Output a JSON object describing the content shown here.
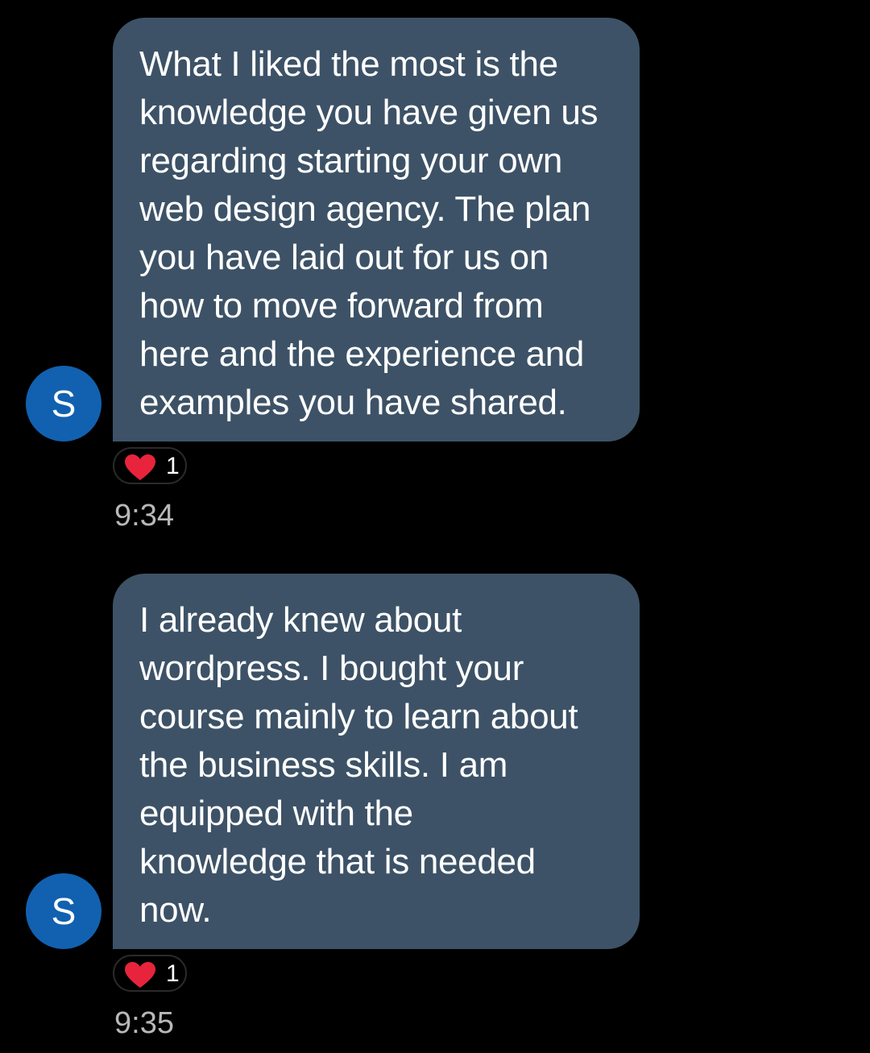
{
  "messages": [
    {
      "sender_initial": "S",
      "text": "What I liked the most is the\nknowledge you have given us\nregarding starting your own\nweb design agency. The plan\nyou have laid out for us on\nhow to move forward from\nhere and the experience and\nexamples you have shared.",
      "reaction": {
        "icon": "heart-icon",
        "count": "1",
        "color": "#e8243c"
      },
      "time": "9:34"
    },
    {
      "sender_initial": "S",
      "text": "I already knew about\nwordpress. I bought your\ncourse mainly to learn about\nthe business skills. I am\nequipped with the\nknowledge that is needed\nnow.",
      "reaction": {
        "icon": "heart-icon",
        "count": "1",
        "color": "#e8243c"
      },
      "time": "9:35"
    }
  ],
  "colors": {
    "background": "#000000",
    "bubble": "#3d5266",
    "avatar": "#1161b0",
    "timestamp": "#b8b8b8"
  }
}
